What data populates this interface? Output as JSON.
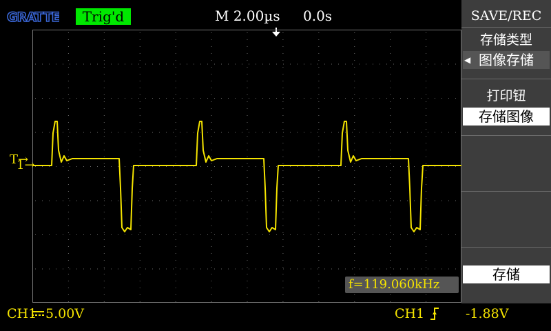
{
  "header": {
    "logo_text": "GRATTEN",
    "trigger_status": "Trig'd",
    "timebase": "M 2.00µs",
    "horizontal_position": "0.0s"
  },
  "markers": {
    "ch1": "1→",
    "trigger": "T→"
  },
  "measurement": {
    "frequency": "f=119.060kHz"
  },
  "footer": {
    "ch1_label": "CH1",
    "ch1_scale": "5.00V",
    "trigger_source": "CH1",
    "trigger_level": "-1.88V"
  },
  "menu": {
    "title": "SAVE/REC",
    "items": [
      {
        "label": "存储类型",
        "value": "图像存储"
      },
      {
        "label": "打印钮",
        "value": "存储图像"
      },
      {
        "label": "",
        "value": ""
      },
      {
        "label": "",
        "value": ""
      },
      {
        "label": "",
        "value": "存储"
      }
    ]
  },
  "colors": {
    "trace": "#f5e400",
    "trigger_badge": "#00e800",
    "menu_bg": "#3d3d3d"
  }
}
